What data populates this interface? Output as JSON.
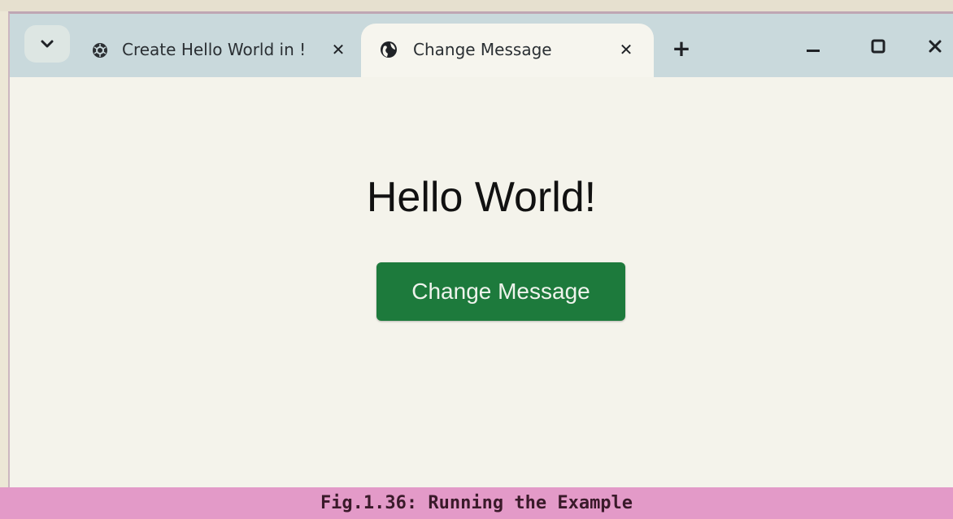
{
  "browser": {
    "tabs": [
      {
        "title": "Create Hello World in !",
        "icon": "openai-logo-icon",
        "active": false
      },
      {
        "title": "Change Message",
        "icon": "globe-icon",
        "active": true
      }
    ],
    "close_glyph": "✕",
    "new_tab_glyph": "+",
    "window_controls": {
      "minimize": "—",
      "maximize": "☐",
      "close": "✕"
    }
  },
  "page": {
    "heading": "Hello World!",
    "button_label": "Change Message"
  },
  "caption": "Fig.1.36: Running the Example",
  "colors": {
    "tabbar": "#c9d9dc",
    "active_tab": "#f6f5ee",
    "button": "#1d7a3c",
    "caption_bar": "#e39ac8"
  }
}
